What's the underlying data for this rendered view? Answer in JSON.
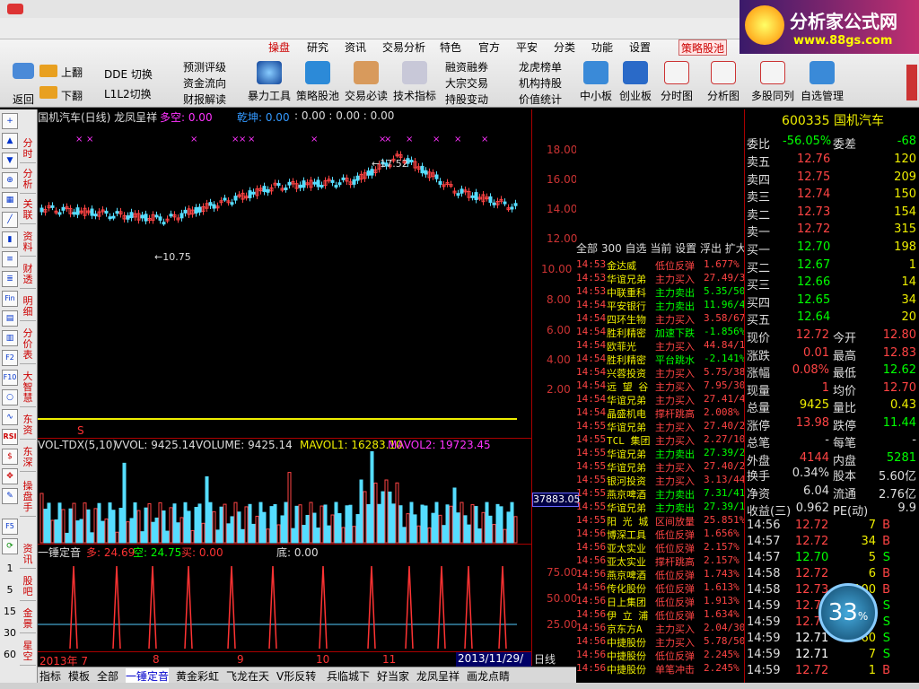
{
  "menu": [
    "操盘",
    "研究",
    "资讯",
    "交易分析",
    "特色",
    "官方",
    "平安",
    "分类",
    "功能",
    "设置",
    "策略股池"
  ],
  "toolbar": {
    "back": "返回",
    "up": "上翻",
    "down": "下翻",
    "ddm": "DDE 切换",
    "l12": "L1L2切换",
    "predict": "预测评级",
    "capflow": "资金流向",
    "report": "财报解读",
    "margin": "融资融券",
    "block": "大宗交易",
    "fundhold": "机构持股",
    "dragon": "龙虎榜单",
    "inst": "机构持股",
    "value": "价值统计",
    "big": [
      "暴力工具",
      "策略股池",
      "交易必读",
      "技术指标",
      "持股变动",
      "价值统计",
      "中小板",
      "创业板",
      "分时图",
      "分析图",
      "多股同列",
      "自选管理"
    ]
  },
  "logo": {
    "title": "分析家公式网",
    "url": "www.88gs.com"
  },
  "lefttools": {
    "v1": "分时",
    "v2": "分析",
    "v3": "关联",
    "v4": "资料",
    "v5": "财透",
    "v6": "明细",
    "v7": "分价表",
    "v8": "大智慧",
    "v9": "东资",
    "v10": "东深",
    "v11": "操盘手",
    "v12": "资讯",
    "v13": "股吧",
    "v14": "金景",
    "v15": "星空",
    "nums": [
      "1",
      "5",
      "15",
      "30",
      "60"
    ],
    "rsi": "RSI",
    "fin": "Fin",
    "f10": "F10",
    "f5": "F5",
    "f2": "F2"
  },
  "main": {
    "title": "国机汽车(日线) 龙凤呈祥",
    "duo": "多空: 0.00",
    "liang": "乾坤: 0.00",
    "extra": ": 0.00 : 0.00 : 0.00",
    "yticks": [
      "18.00",
      "16.00",
      "14.00",
      "12.00",
      "10.00",
      "8.00",
      "6.00",
      "4.00",
      "2.00"
    ],
    "high": "17.52",
    "low": "10.75"
  },
  "vol": {
    "title": "VOL-TDX(5,10)",
    "vvol": "VVOL: 9425.14",
    "volume": "VOLUME: 9425.14",
    "mavol1": "MAVOL1: 16283.10",
    "mavol2": "MAVOL2: 19723.45",
    "ylabel": "37883.05"
  },
  "ind": {
    "title": "一锤定音",
    "duo": "多: 24.69",
    "kong": "空: 24.75",
    "mai": "买: 0.00",
    "di": "底: 0.00",
    "yticks": [
      "75.00",
      "50.00",
      "25.00"
    ]
  },
  "dates": {
    "year": "2013年 7",
    "m8": "8",
    "m9": "9",
    "m10": "10",
    "m11": "11",
    "cur": "2013/11/29/五",
    "period": "日线"
  },
  "tape": {
    "tabs": "全部 300 自选 当前 设置 浮出 扩大",
    "rows": [
      [
        "14:53",
        "金达威",
        "低位反弹",
        "1.677%",
        "r"
      ],
      [
        "14:53",
        "华谊兄弟",
        "主力买入",
        "27.49/3",
        "r"
      ],
      [
        "14:53",
        "中联重科",
        "主力卖出",
        "5.35/50",
        "g"
      ],
      [
        "14:54",
        "平安银行",
        "主力卖出",
        "11.96/4",
        "g"
      ],
      [
        "14:54",
        "四环生物",
        "主力买入",
        "3.58/67",
        "r"
      ],
      [
        "14:54",
        "胜利精密",
        "加速下跌",
        "-1.856%",
        "g"
      ],
      [
        "14:54",
        "欧菲光",
        "主力买入",
        "44.84/1",
        "r"
      ],
      [
        "14:54",
        "胜利精密",
        "平台跳水",
        "-2.141%",
        "g"
      ],
      [
        "14:54",
        "兴蓉投资",
        "主力买入",
        "5.75/38",
        "r"
      ],
      [
        "14:54",
        "远 望 谷",
        "主力买入",
        "7.95/30",
        "r"
      ],
      [
        "14:54",
        "华谊兄弟",
        "主力买入",
        "27.41/4",
        "r"
      ],
      [
        "14:54",
        "晶盛机电",
        "撑杆跳高",
        "2.008%",
        "r"
      ],
      [
        "14:55",
        "华谊兄弟",
        "主力买入",
        "27.40/2",
        "r"
      ],
      [
        "14:55",
        "TCL 集团",
        "主力买入",
        "2.27/10",
        "r"
      ],
      [
        "14:55",
        "华谊兄弟",
        "主力卖出",
        "27.39/2",
        "g"
      ],
      [
        "14:55",
        "华谊兄弟",
        "主力买入",
        "27.40/2",
        "r"
      ],
      [
        "14:55",
        "银河投资",
        "主力买入",
        "3.13/44",
        "r"
      ],
      [
        "14:55",
        "燕京啤酒",
        "主力卖出",
        "7.31/41",
        "g"
      ],
      [
        "14:55",
        "华谊兄弟",
        "主力卖出",
        "27.39/1",
        "g"
      ],
      [
        "14:55",
        "阳 光 城",
        "区间放量",
        "25.851%",
        "r"
      ],
      [
        "14:56",
        "博深工具",
        "低位反弹",
        "1.656%",
        "r"
      ],
      [
        "14:56",
        "亚太实业",
        "低位反弹",
        "2.157%",
        "r"
      ],
      [
        "14:56",
        "亚太实业",
        "撑杆跳高",
        "2.157%",
        "r"
      ],
      [
        "14:56",
        "燕京啤酒",
        "低位反弹",
        "1.743%",
        "r"
      ],
      [
        "14:56",
        "传化股份",
        "低位反弹",
        "1.613%",
        "r"
      ],
      [
        "14:56",
        "日上集团",
        "低位反弹",
        "1.913%",
        "r"
      ],
      [
        "14:56",
        "伊 立 浦",
        "低位反弹",
        "1.634%",
        "r"
      ],
      [
        "14:56",
        "京东方A",
        "主力买入",
        "2.04/30",
        "r"
      ],
      [
        "14:56",
        "中捷股份",
        "主力买入",
        "5.78/50",
        "r"
      ],
      [
        "14:56",
        "中捷股份",
        "低位反弹",
        "2.245%",
        "r"
      ],
      [
        "14:56",
        "中捷股份",
        "单笔冲击",
        "2.245%",
        "r"
      ]
    ]
  },
  "quote": {
    "code": "600335",
    "name": "国机汽车",
    "weibi": "委比",
    "weibi_v": "-56.05%",
    "weicha": "委差",
    "weicha_v": "-68",
    "asks": [
      [
        "卖五",
        "12.76",
        "120"
      ],
      [
        "卖四",
        "12.75",
        "209"
      ],
      [
        "卖三",
        "12.74",
        "150"
      ],
      [
        "卖二",
        "12.73",
        "154"
      ],
      [
        "卖一",
        "12.72",
        "315"
      ]
    ],
    "bids": [
      [
        "买一",
        "12.70",
        "198"
      ],
      [
        "买二",
        "12.67",
        "1"
      ],
      [
        "买三",
        "12.66",
        "14"
      ],
      [
        "买四",
        "12.65",
        "34"
      ],
      [
        "买五",
        "12.64",
        "20"
      ]
    ],
    "stats": [
      [
        "现价",
        "12.72",
        "今开",
        "12.80"
      ],
      [
        "涨跌",
        "0.01",
        "最高",
        "12.83"
      ],
      [
        "涨幅",
        "0.08%",
        "最低",
        "12.62"
      ],
      [
        "现量",
        "1",
        "均价",
        "12.70"
      ],
      [
        "总量",
        "9425",
        "量比",
        "0.43"
      ],
      [
        "涨停",
        "13.98",
        "跌停",
        "11.44"
      ],
      [
        "总笔",
        "-",
        "每笔",
        "-"
      ],
      [
        "外盘",
        "4144",
        "内盘",
        "5281"
      ],
      [
        "换手",
        "0.34%",
        "股本",
        "5.60亿"
      ],
      [
        "净资",
        "6.04",
        "流通",
        "2.76亿"
      ],
      [
        "收益(三)",
        "0.962",
        "PE(动)",
        "9.9"
      ]
    ],
    "ticks": [
      [
        "14:56",
        "12.72",
        "7",
        "B"
      ],
      [
        "14:57",
        "12.72",
        "34",
        "B"
      ],
      [
        "14:57",
        "12.70",
        "5",
        "S"
      ],
      [
        "14:58",
        "12.72",
        "6",
        "B"
      ],
      [
        "14:58",
        "12.73",
        "100",
        "B"
      ],
      [
        "14:59",
        "12.72",
        "",
        "S"
      ],
      [
        "14:59",
        "12.72",
        "",
        "S"
      ],
      [
        "14:59",
        "12.71",
        "60",
        "S"
      ],
      [
        "14:59",
        "12.71",
        "7",
        "S"
      ],
      [
        "14:59",
        "12.72",
        "1",
        "B"
      ]
    ],
    "badge": "33"
  },
  "tabs": [
    "指标",
    "模板",
    "全部",
    "一锤定音",
    "黄金彩虹",
    "飞龙在天",
    "V形反转",
    "兵临城下",
    "好当家",
    "龙凤呈祥",
    "画龙点睛"
  ]
}
